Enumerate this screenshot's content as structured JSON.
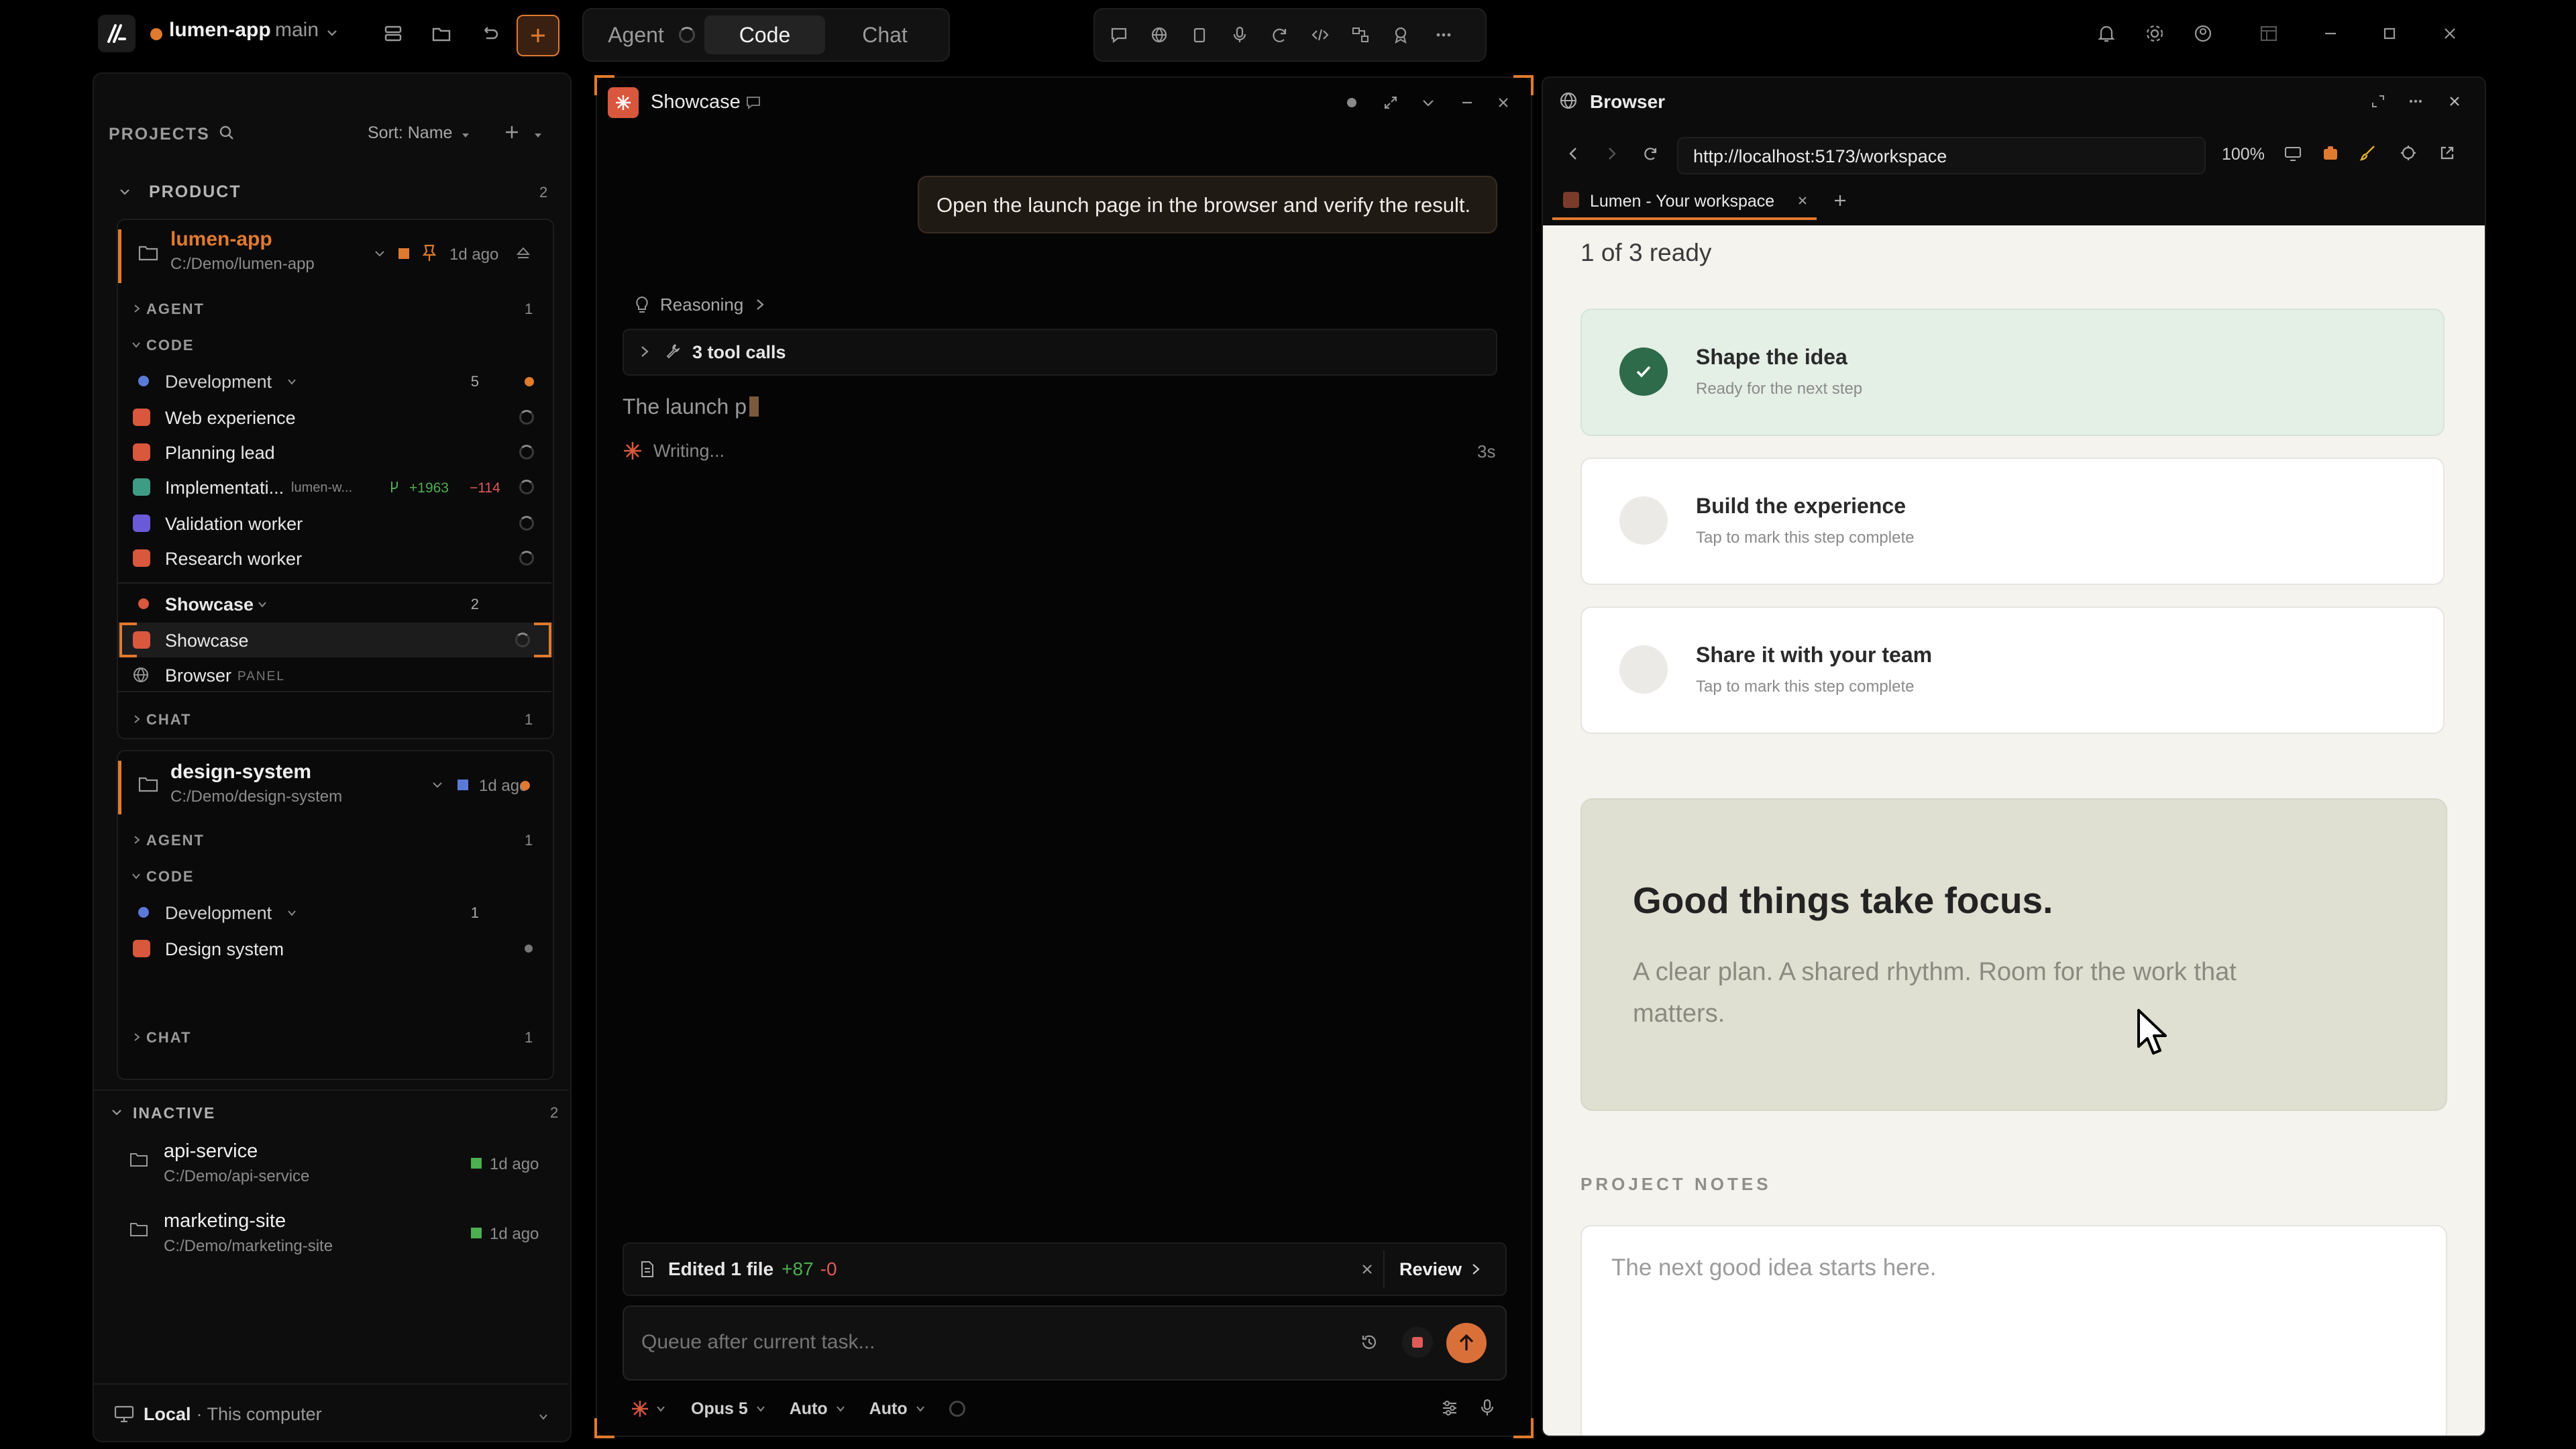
{
  "topbar": {
    "project_name": "lumen-app",
    "branch": "main",
    "modes": [
      "Agent",
      "Code",
      "Chat"
    ],
    "active_mode": "Code"
  },
  "sidebar": {
    "projects_label": "PROJECTS",
    "sort_label": "Sort: Name",
    "product_group": {
      "label": "PRODUCT",
      "count": "2"
    },
    "lumen": {
      "name": "lumen-app",
      "path": "C:/Demo/lumen-app",
      "time": "1d ago",
      "agent_label": "AGENT",
      "agent_count": "1",
      "code_label": "CODE",
      "dev_label": "Development",
      "dev_count": "5",
      "items": [
        {
          "label": "Web experience"
        },
        {
          "label": "Planning lead"
        },
        {
          "label": "Implementati...",
          "tag": "lumen-w...",
          "added": "+1963",
          "removed": "−114"
        },
        {
          "label": "Validation worker"
        },
        {
          "label": "Research worker"
        }
      ],
      "showcase_group": {
        "label": "Showcase",
        "count": "2"
      },
      "showcase_item": "Showcase",
      "browser_item": "Browser",
      "browser_badge": "PANEL",
      "chat_label": "CHAT",
      "chat_count": "1"
    },
    "design": {
      "name": "design-system",
      "path": "C:/Demo/design-system",
      "time": "1d ago",
      "agent_label": "AGENT",
      "agent_count": "1",
      "code_label": "CODE",
      "dev_label": "Development",
      "dev_count": "1",
      "item": "Design system",
      "chat_label": "CHAT",
      "chat_count": "1"
    },
    "inactive": {
      "label": "INACTIVE",
      "count": "2",
      "projects": [
        {
          "name": "api-service",
          "path": "C:/Demo/api-service",
          "time": "1d ago"
        },
        {
          "name": "marketing-site",
          "path": "C:/Demo/marketing-site",
          "time": "1d ago"
        }
      ]
    },
    "footer": {
      "location": "Local",
      "sub": "· This computer"
    }
  },
  "chat": {
    "title": "Showcase",
    "user_message": "Open the launch page in the browser and verify the result.",
    "reasoning_label": "Reasoning",
    "tool_calls_label": "3 tool calls",
    "partial_response": "The launch p",
    "writing_label": "Writing...",
    "writing_time": "3s",
    "edited_label": "Edited 1 file",
    "edited_added": "+87",
    "edited_removed": "-0",
    "review_label": "Review",
    "input_placeholder": "Queue after current task...",
    "model": "Opus 5",
    "option1": "Auto",
    "option2": "Auto"
  },
  "browser": {
    "title": "Browser",
    "url": "http://localhost:5173/workspace",
    "zoom": "100%",
    "tab_title": "Lumen - Your workspace",
    "page": {
      "progress": "1 of 3 ready",
      "steps": [
        {
          "title": "Shape the idea",
          "sub": "Ready for the next step",
          "done": true
        },
        {
          "title": "Build the experience",
          "sub": "Tap to mark this step complete",
          "done": false
        },
        {
          "title": "Share it with your team",
          "sub": "Tap to mark this step complete",
          "done": false
        }
      ],
      "hero_title": "Good things take focus.",
      "hero_body": "A clear plan. A shared rhythm. Room for the work that matters.",
      "notes_label": "PROJECT NOTES",
      "notes_placeholder": "The next good idea starts here."
    }
  },
  "colors": {
    "accent": "#e07a2f",
    "success": "#2d6b4a",
    "added": "#4caf50",
    "removed": "#e05a5a"
  }
}
